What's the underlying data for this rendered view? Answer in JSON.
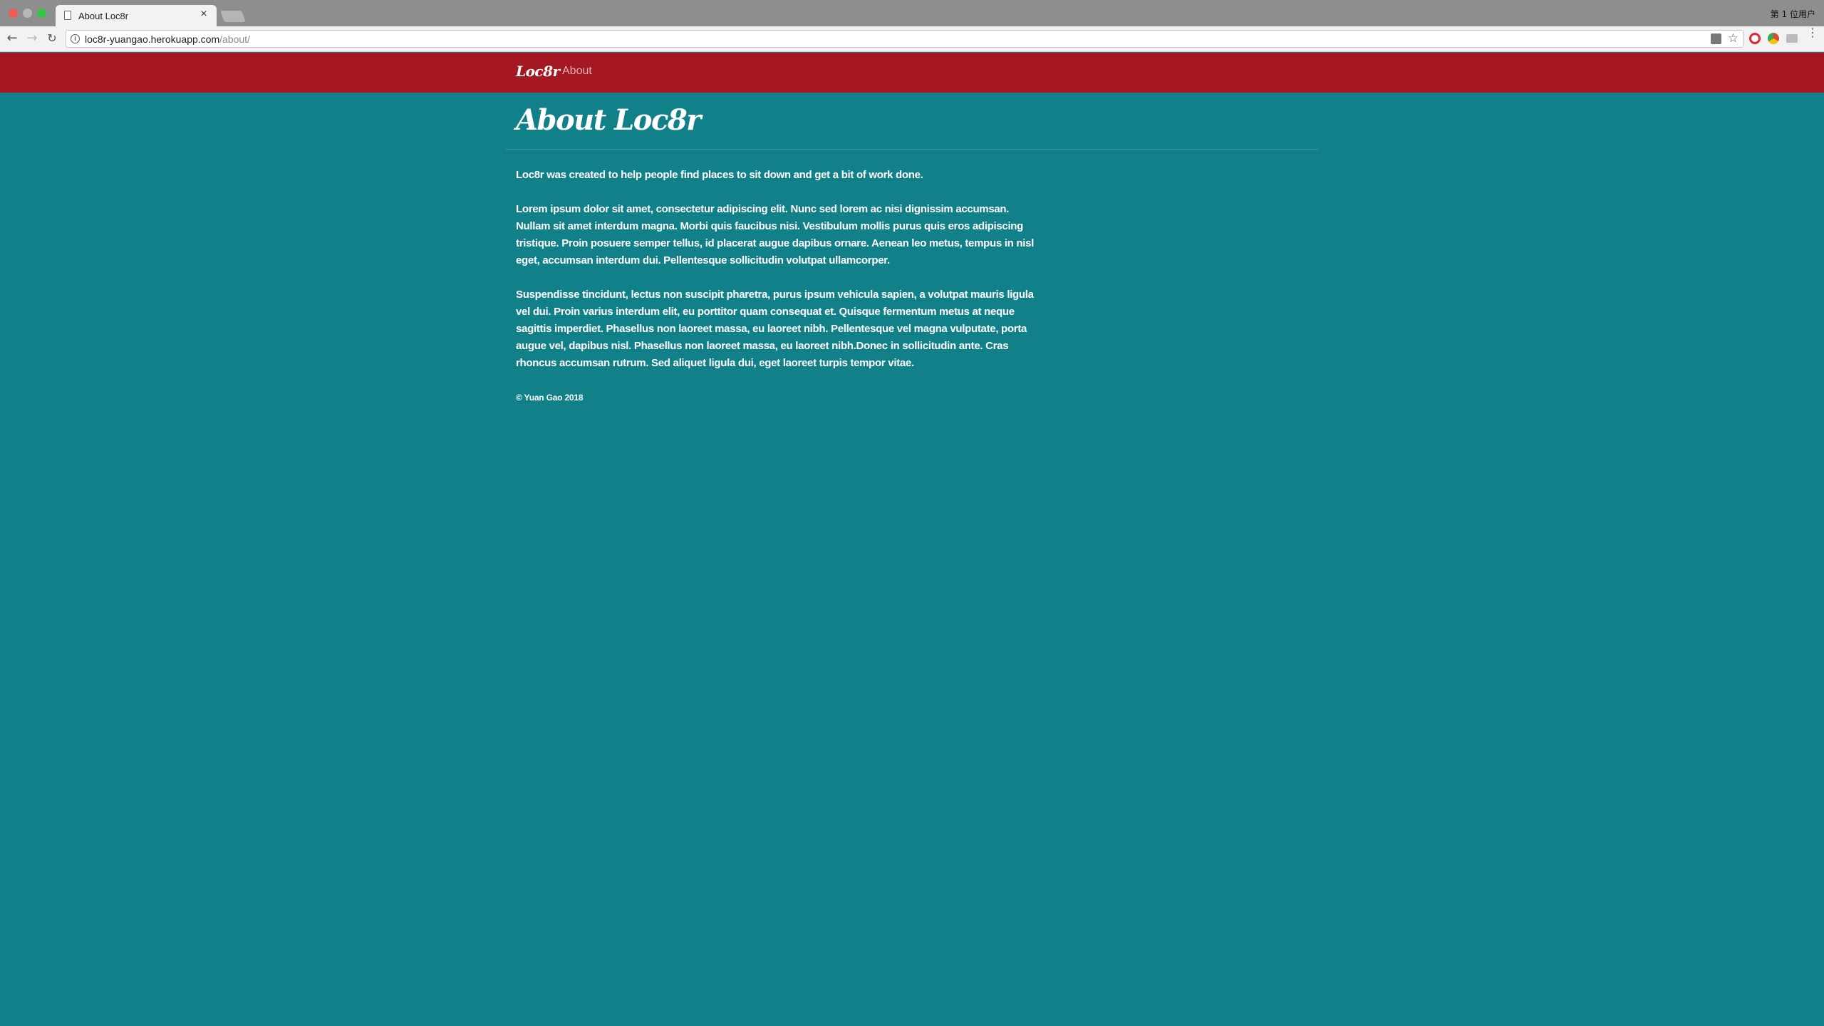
{
  "browser": {
    "tab_title": "About Loc8r",
    "tab_close": "×",
    "profile_label": "第 1 位用户",
    "url_host": "loc8r-yuangao.herokuapp.com",
    "url_path": "/about/",
    "back_glyph": "←",
    "forward_glyph": "→",
    "reload_glyph": "↻",
    "info_glyph": "i",
    "star_glyph": "☆",
    "menu_glyph": "⋮"
  },
  "navbar": {
    "brand": "Loc8r",
    "about_link": "About",
    "background_color": "#a51722"
  },
  "page": {
    "title": "About Loc8r",
    "background_color": "#128089",
    "paragraphs": [
      "Loc8r was created to help people find places to sit down and get a bit of work done.",
      "Lorem ipsum dolor sit amet, consectetur adipiscing elit. Nunc sed lorem ac nisi dignissim accumsan. Nullam sit amet interdum magna. Morbi quis faucibus nisi. Vestibulum mollis purus quis eros adipiscing tristique. Proin posuere semper tellus, id placerat augue dapibus ornare. Aenean leo metus, tempus in nisl eget, accumsan interdum dui. Pellentesque sollicitudin volutpat ullamcorper.",
      "Suspendisse tincidunt, lectus non suscipit pharetra, purus ipsum vehicula sapien, a volutpat mauris ligula vel dui. Proin varius interdum elit, eu porttitor quam consequat et. Quisque fermentum metus at neque sagittis imperdiet. Phasellus non laoreet massa, eu laoreet nibh. Pellentesque vel magna vulputate, porta augue vel, dapibus nisl. Phasellus non laoreet massa, eu laoreet nibh.Donec in sollicitudin ante. Cras rhoncus accumsan rutrum. Sed aliquet ligula dui, eget laoreet turpis tempor vitae."
    ],
    "copyright": "© Yuan Gao 2018"
  }
}
